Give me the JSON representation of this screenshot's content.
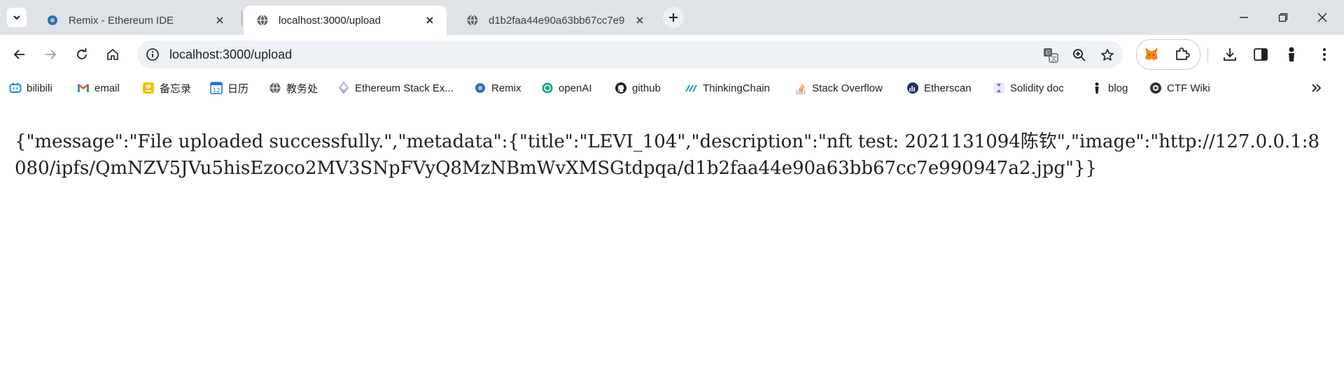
{
  "tabs": [
    {
      "title": "Remix - Ethereum IDE",
      "icon": "remix-icon",
      "active": false
    },
    {
      "title": "localhost:3000/upload",
      "icon": "globe-icon",
      "active": true
    },
    {
      "title": "d1b2faa44e90a63bb67cc7e9",
      "icon": "globe-icon",
      "active": false
    }
  ],
  "address_bar": {
    "url": "localhost:3000/upload"
  },
  "bookmarks": [
    {
      "label": "bilibili",
      "icon": "bilibili-icon",
      "color": "#1e88e5"
    },
    {
      "label": "email",
      "icon": "gmail-icon",
      "color": "#ea4335"
    },
    {
      "label": "备忘录",
      "icon": "notes-icon",
      "color": "#fbbc04"
    },
    {
      "label": "日历",
      "icon": "calendar-icon",
      "color": "#1a73e8"
    },
    {
      "label": "教务处",
      "icon": "globe-icon",
      "color": "#5f6368"
    },
    {
      "label": "Ethereum Stack Ex...",
      "icon": "ethereum-icon",
      "color": "#8a92b2"
    },
    {
      "label": "Remix",
      "icon": "remix-icon",
      "color": "#2f6fb6"
    },
    {
      "label": "openAI",
      "icon": "openai-icon",
      "color": "#10a37f"
    },
    {
      "label": "github",
      "icon": "github-icon",
      "color": "#1f1f1f"
    },
    {
      "label": "ThinkingChain",
      "icon": "thinkingchain-icon",
      "color": "#1aa3c8"
    },
    {
      "label": "Stack Overflow",
      "icon": "stackoverflow-icon",
      "color": "#f48024"
    },
    {
      "label": "Etherscan",
      "icon": "etherscan-icon",
      "color": "#21325b"
    },
    {
      "label": "Solidity doc",
      "icon": "solidity-icon",
      "color": "#6b5fa5"
    },
    {
      "label": "blog",
      "icon": "blog-icon",
      "color": "#1f1f1f"
    },
    {
      "label": "CTF Wiki",
      "icon": "ctfwiki-icon",
      "color": "#333333"
    }
  ],
  "page": {
    "response_text": "{\"message\":\"File uploaded successfully.\",\"metadata\":{\"title\":\"LEVI_104\",\"description\":\"nft test: 2021131094陈钦\",\"image\":\"http://127.0.0.1:8080/ipfs/QmNZV5JVu5hisEzoco2MV3SNpFVyQ8MzNBmWvXMSGtdpqa/d1b2faa44e90a63bb67cc7e990947a2.jpg\"}}"
  }
}
